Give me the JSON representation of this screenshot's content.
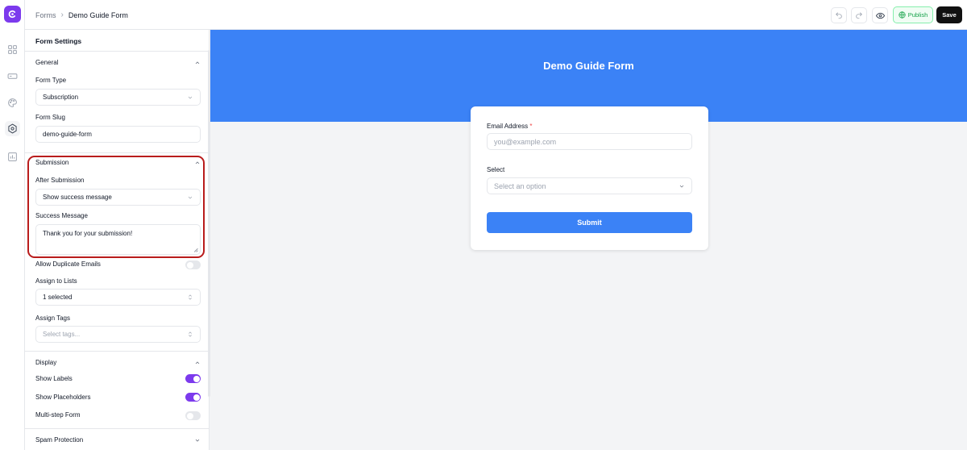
{
  "breadcrumb": {
    "root": "Forms",
    "current": "Demo Guide Form"
  },
  "toolbar": {
    "publish_label": "Publish",
    "save_label": "Save"
  },
  "panel": {
    "title": "Form Settings",
    "general": {
      "heading": "General",
      "form_type_label": "Form Type",
      "form_type_value": "Subscription",
      "form_slug_label": "Form Slug",
      "form_slug_value": "demo-guide-form"
    },
    "submission": {
      "heading": "Submission",
      "after_label": "After Submission",
      "after_value": "Show success message",
      "message_label": "Success Message",
      "message_value": "Thank you for your submission!",
      "allow_duplicates_label": "Allow Duplicate Emails",
      "allow_duplicates_on": false,
      "assign_lists_label": "Assign to Lists",
      "assign_lists_value": "1 selected",
      "assign_tags_label": "Assign Tags",
      "assign_tags_placeholder": "Select tags..."
    },
    "display": {
      "heading": "Display",
      "show_labels_label": "Show Labels",
      "show_labels_on": true,
      "show_placeholders_label": "Show Placeholders",
      "show_placeholders_on": true,
      "multistep_label": "Multi-step Form",
      "multistep_on": false
    },
    "spam": {
      "heading": "Spam Protection"
    }
  },
  "preview": {
    "title": "Demo Guide Form",
    "email_label": "Email Address",
    "email_required_mark": "*",
    "email_placeholder": "you@example.com",
    "select_label": "Select",
    "select_placeholder": "Select an option",
    "submit_label": "Submit"
  },
  "colors": {
    "brand": "#7c3aed",
    "banner": "#3b82f6",
    "publish": "#16a34a",
    "highlight": "#b91c1c"
  }
}
